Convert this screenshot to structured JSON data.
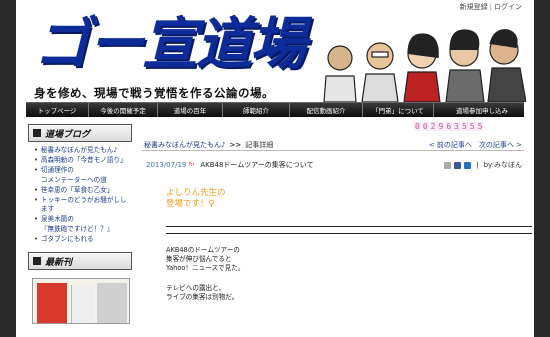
{
  "top_links": {
    "register": "新規登録",
    "login": "ログイン"
  },
  "header": {
    "logo_text": "ゴー宣道場",
    "tagline": "身を修め、現場で戦う覚悟を作る公論の場。"
  },
  "nav": [
    {
      "label": "トップページ"
    },
    {
      "label": "今後の開催予定"
    },
    {
      "label": "道場の百年"
    },
    {
      "label": "師範紹介"
    },
    {
      "label": "配信動画紹介"
    },
    {
      "label": "「門弟」について"
    },
    {
      "label": "道場参加申し込み"
    }
  ],
  "sidebar": {
    "blog_title": "道場ブログ",
    "items": [
      "秘書みなぼんが見たもん♪",
      "高森明勅の「今昔モノ語り」",
      "切通理作の",
      "コメンテーターへの道",
      "笹幸恵の「草食む乙女」",
      "トッキーのどうがお騒がしします",
      "泉美木蘭の",
      "『無鉄砲ですけど！？』",
      "ゴタブンにもれる"
    ],
    "latest_title": "最新刊"
  },
  "counter": [
    "0",
    "0",
    "2",
    "9",
    "6",
    "3",
    "5",
    "5",
    "5"
  ],
  "breadcrumb": {
    "category": "秘書みなぼんが見たもん♪",
    "arrow": ">>",
    "current": "記事詳細"
  },
  "pager": {
    "prev": "< 前の記事へ",
    "next": "次の記事へ >"
  },
  "post": {
    "date": "2013/07/19",
    "date_mark": "Fri",
    "title": "AKB48ドームツアーの集客について",
    "author": "by:みなぼん",
    "greeting_line1": "よしりん先生の",
    "greeting_line2": "登場です！♀",
    "para1": [
      "AKB48のドームツアーの",
      "集客が伸び悩んでると",
      "Yahoo！ニュースで見た。"
    ],
    "para2": [
      "テレビへの露出と、",
      "ライブの集客は別物だ。"
    ]
  }
}
